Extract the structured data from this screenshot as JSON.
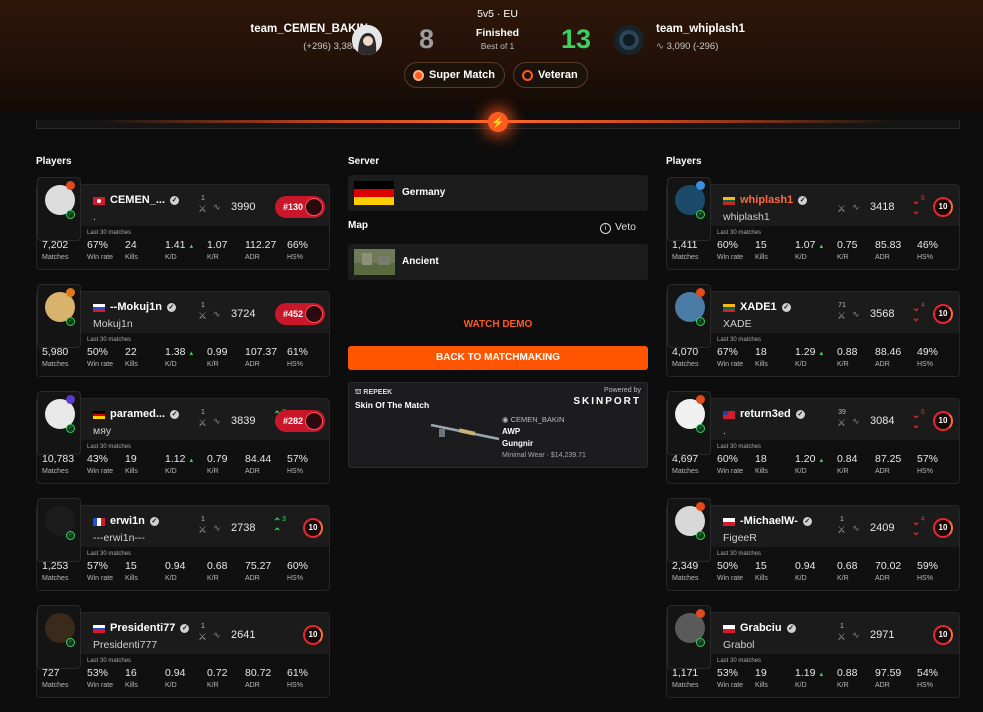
{
  "match": {
    "mode": "5v5 · EU",
    "status": "Finished",
    "format": "Best of 1",
    "score_left": "8",
    "score_right": "13",
    "badge_super": "Super Match",
    "badge_veteran": "Veteran"
  },
  "team_left": {
    "name": "team_CEMEN_BAKIN",
    "elo_line": "(+296) 3,386"
  },
  "team_right": {
    "name": "team_whiplash1",
    "elo_line": "3,090 (-296)"
  },
  "labels": {
    "players": "Players",
    "server": "Server",
    "map": "Map",
    "veto": "Veto",
    "last30": "Last 30 matches",
    "watch_demo": "WATCH DEMO",
    "back_mm": "BACK TO MATCHMAKING"
  },
  "server": {
    "name": "Germany"
  },
  "map": {
    "name": "Ancient"
  },
  "stat_labels": {
    "matches": "Matches",
    "winrate": "Win rate",
    "kills": "Kills",
    "kd": "K/D",
    "kr": "K/R",
    "adr": "ADR",
    "hs": "HS%"
  },
  "skin": {
    "brand": "REPEEK",
    "title": "Skin Of The Match",
    "powered": "Powered by",
    "partner": "SKINPORT",
    "owner": "CEMEN_BAKIN",
    "weapon": "AWP",
    "skin_name": "Gungnir",
    "wear_price": "Minimal Wear · $14,239.71"
  },
  "left_players": [
    {
      "name": "CEMEN_...",
      "nick": ".",
      "party": "1",
      "elo": "3990",
      "rank": "#130",
      "matches": "7,202",
      "winrate": "67%",
      "kills": "24",
      "kd": "1.41",
      "kr": "1.07",
      "adr": "112.27",
      "hs": "66%"
    },
    {
      "name": "--Mokuj1n",
      "nick": "Mokuj1n",
      "party": "1",
      "elo": "3724",
      "rank": "#452",
      "matches": "5,980",
      "winrate": "50%",
      "kills": "22",
      "kd": "1.38",
      "kr": "0.99",
      "adr": "107.37",
      "hs": "61%"
    },
    {
      "name": "paramed...",
      "nick": "мяу",
      "party": "1",
      "elo": "3839",
      "change": "2",
      "rank": "#282",
      "matches": "10,783",
      "winrate": "43%",
      "kills": "19",
      "kd": "1.12",
      "kr": "0.79",
      "adr": "84.44",
      "hs": "57%"
    },
    {
      "name": "erwi1n",
      "nick": "---erwi1n---",
      "party": "1",
      "elo": "2738",
      "change": "3",
      "level": "10",
      "matches": "1,253",
      "winrate": "57%",
      "kills": "15",
      "kd": "0.94",
      "kr": "0.68",
      "adr": "75.27",
      "hs": "60%"
    },
    {
      "name": "Presidenti77",
      "nick": "Presidenti777",
      "party": "1",
      "elo": "2641",
      "level": "10",
      "matches": "727",
      "winrate": "53%",
      "kills": "16",
      "kd": "0.94",
      "kr": "0.72",
      "adr": "80.72",
      "hs": "61%"
    }
  ],
  "right_players": [
    {
      "name": "whiplash1",
      "nick": "whiplash1",
      "elo": "3418",
      "change": "6",
      "level": "10",
      "matches": "1,411",
      "winrate": "60%",
      "kills": "15",
      "kd": "1.07",
      "kr": "0.75",
      "adr": "85.83",
      "hs": "46%"
    },
    {
      "name": "XADE1",
      "nick": "XADE",
      "party": "71",
      "elo": "3568",
      "change": "4",
      "level": "10",
      "matches": "4,070",
      "winrate": "67%",
      "kills": "18",
      "kd": "1.29",
      "kr": "0.88",
      "adr": "88.46",
      "hs": "49%"
    },
    {
      "name": "return3ed",
      "nick": ".",
      "party": "39",
      "elo": "3084",
      "change": "6",
      "level": "10",
      "matches": "4,697",
      "winrate": "60%",
      "kills": "18",
      "kd": "1.20",
      "kr": "0.84",
      "adr": "87.25",
      "hs": "57%"
    },
    {
      "name": "-MichaelW-",
      "nick": "FigeeR",
      "party": "1",
      "elo": "2409",
      "change": "4",
      "level": "10",
      "matches": "2,349",
      "winrate": "50%",
      "kills": "15",
      "kd": "0.94",
      "kr": "0.68",
      "adr": "70.02",
      "hs": "59%"
    },
    {
      "name": "Grabciu",
      "nick": "Grabol",
      "party": "1",
      "elo": "2971",
      "level": "10",
      "matches": "1,171",
      "winrate": "53%",
      "kills": "19",
      "kd": "1.19",
      "kr": "0.88",
      "adr": "97.59",
      "hs": "54%"
    }
  ],
  "colors": {
    "accent": "#ff5500",
    "win": "#3ad15e",
    "loss": "#e8262e",
    "highlight_name": "#ff6a3d"
  }
}
